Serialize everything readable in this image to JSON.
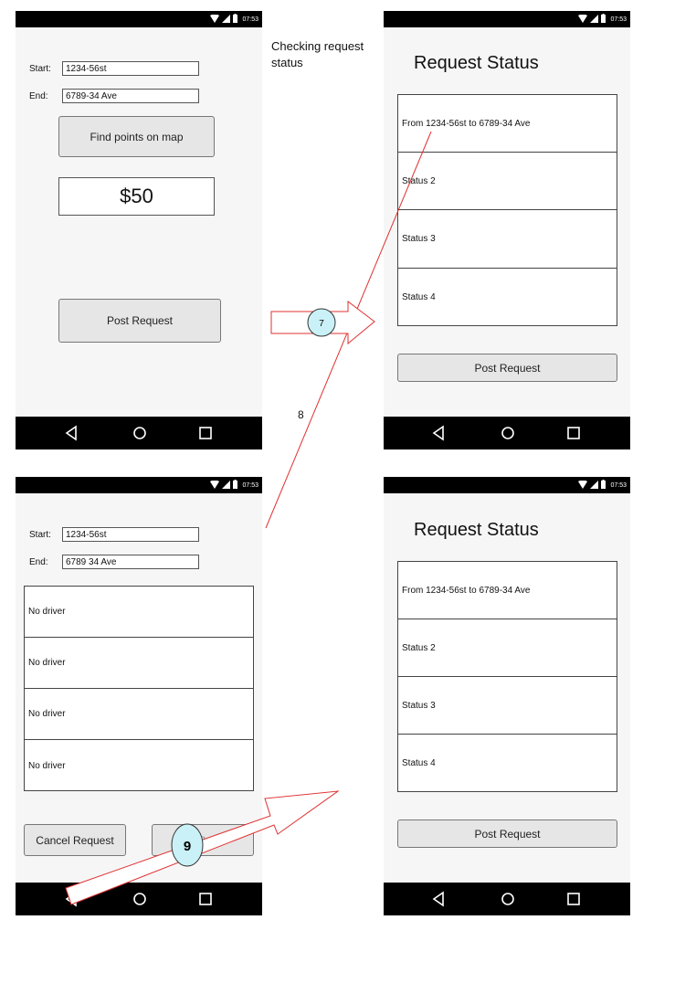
{
  "caption": "Checking request status",
  "edge_8_label": "8",
  "step_7": "7",
  "step_9": "9",
  "status_time": "07:53",
  "screen1": {
    "start_label": "Start:",
    "start_value": "1234-56st",
    "end_label": "End:",
    "end_value": "6789-34 Ave",
    "find_button": "Find points on map",
    "price": "$50",
    "post_button": "Post Request"
  },
  "screen2": {
    "title": "Request Status",
    "rows": [
      "From 1234-56st to 6789-34 Ave",
      "Status 2",
      "Status 3",
      "Status 4"
    ],
    "post_button": "Post Request"
  },
  "screen3": {
    "start_label": "Start:",
    "start_value": "1234-56st",
    "end_label": "End:",
    "end_value": "6789 34 Ave",
    "rows": [
      "No driver",
      "No driver",
      "No driver",
      "No driver"
    ],
    "cancel_button": "Cancel Request",
    "second_button": "9"
  },
  "screen4": {
    "title": "Request Status",
    "rows": [
      "From 1234-56st to 6789-34 Ave",
      "Status 2",
      "Status 3",
      "Status 4"
    ],
    "post_button": "Post Request"
  },
  "colors": {
    "arrow_red": "#e03030",
    "badge_fill": "#c9f1f7"
  }
}
